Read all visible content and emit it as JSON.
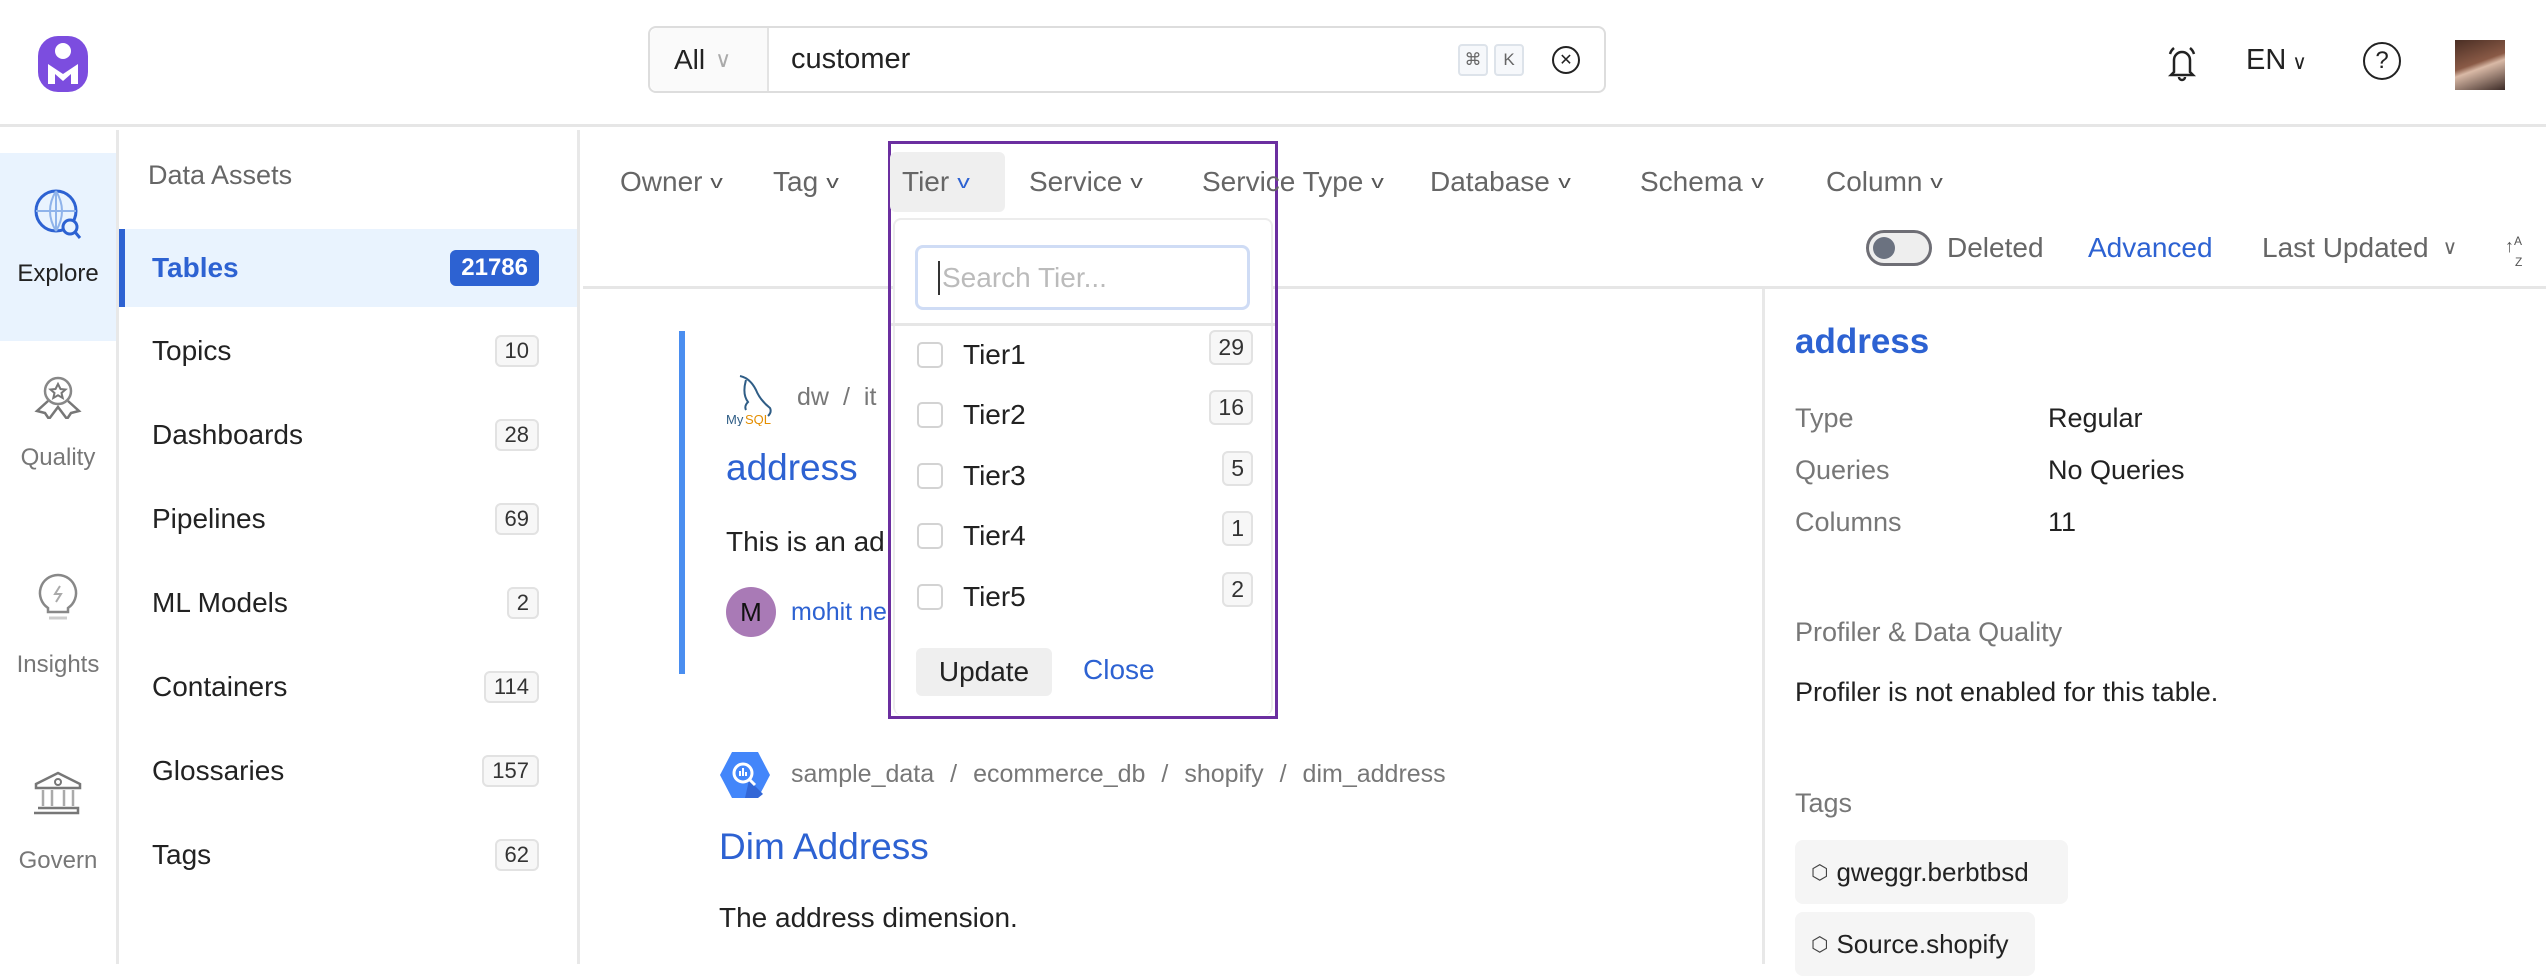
{
  "header": {
    "search_scope": "All",
    "search_value": "customer",
    "shortcut_keys": [
      "⌘",
      "K"
    ],
    "language": "EN"
  },
  "rail": {
    "items": [
      {
        "label": "Explore",
        "icon": "globe-search-icon",
        "active": true
      },
      {
        "label": "Quality",
        "icon": "award-ribbon-icon"
      },
      {
        "label": "Insights",
        "icon": "lightbulb-icon"
      },
      {
        "label": "Govern",
        "icon": "bank-building-icon"
      }
    ]
  },
  "assets": {
    "title": "Data Assets",
    "items": [
      {
        "label": "Tables",
        "count": "21786",
        "active": true
      },
      {
        "label": "Topics",
        "count": "10"
      },
      {
        "label": "Dashboards",
        "count": "28"
      },
      {
        "label": "Pipelines",
        "count": "69"
      },
      {
        "label": "ML Models",
        "count": "2"
      },
      {
        "label": "Containers",
        "count": "114"
      },
      {
        "label": "Glossaries",
        "count": "157"
      },
      {
        "label": "Tags",
        "count": "62"
      }
    ]
  },
  "filters": {
    "items": [
      "Owner",
      "Tag",
      "Tier",
      "Service",
      "Service Type",
      "Database",
      "Schema",
      "Column"
    ],
    "deleted_label": "Deleted",
    "deleted_on": false,
    "advanced_label": "Advanced",
    "sort_label": "Last Updated"
  },
  "tier_dropdown": {
    "placeholder": "Search Tier...",
    "options": [
      {
        "label": "Tier1",
        "count": "29",
        "checked": false
      },
      {
        "label": "Tier2",
        "count": "16",
        "checked": false
      },
      {
        "label": "Tier3",
        "count": "5",
        "checked": false
      },
      {
        "label": "Tier4",
        "count": "1",
        "checked": false
      },
      {
        "label": "Tier5",
        "count": "2",
        "checked": false
      }
    ],
    "update_label": "Update",
    "close_label": "Close"
  },
  "results": [
    {
      "breadcrumb": [
        "dw",
        "it"
      ],
      "title": "address",
      "description": "This is an ad",
      "owner_initial": "M",
      "owner": "mohit ne",
      "service_icon": "mysql-logo"
    },
    {
      "breadcrumb": [
        "sample_data",
        "ecommerce_db",
        "shopify",
        "dim_address"
      ],
      "title": "Dim Address",
      "description": "The address dimension.",
      "service_icon": "bigquery-icon"
    }
  ],
  "details": {
    "title": "address",
    "props": [
      {
        "label": "Type",
        "value": "Regular"
      },
      {
        "label": "Queries",
        "value": "No Queries"
      },
      {
        "label": "Columns",
        "value": "11"
      }
    ],
    "profiler_title": "Profiler & Data Quality",
    "profiler_text": "Profiler is not enabled for this table.",
    "tags_title": "Tags",
    "tags": [
      "gweggr.berbtbsd",
      "Source.shopify"
    ]
  },
  "colors": {
    "accent": "#2d62d2",
    "dropdown_border": "#6b2fa0",
    "selected_bar": "#4a8ef0"
  }
}
